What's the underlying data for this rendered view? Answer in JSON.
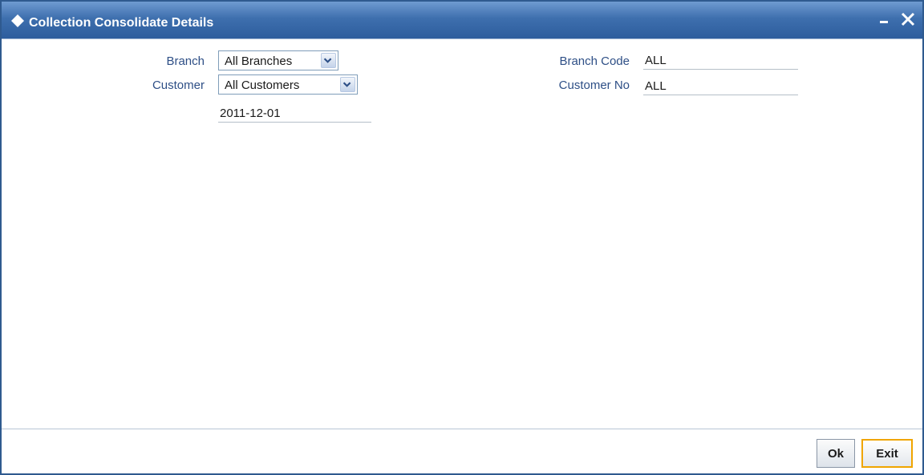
{
  "window": {
    "title": "Collection Consolidate Details",
    "title_icon": "diamond-icon",
    "minimize_icon": "minimize-icon",
    "close_icon": "close-icon"
  },
  "form": {
    "branch_label": "Branch",
    "branch_value": "All Branches",
    "customer_label": "Customer",
    "customer_value": "All Customers",
    "date_value": "2011-12-01",
    "branch_code_label": "Branch Code",
    "branch_code_value": "ALL",
    "customer_no_label": "Customer No",
    "customer_no_value": "ALL"
  },
  "footer": {
    "ok_label": "Ok",
    "exit_label": "Exit"
  },
  "colors": {
    "titlebar": "#3e6fae",
    "label": "#2e4f86",
    "exit_focus_border": "#f0a500"
  }
}
